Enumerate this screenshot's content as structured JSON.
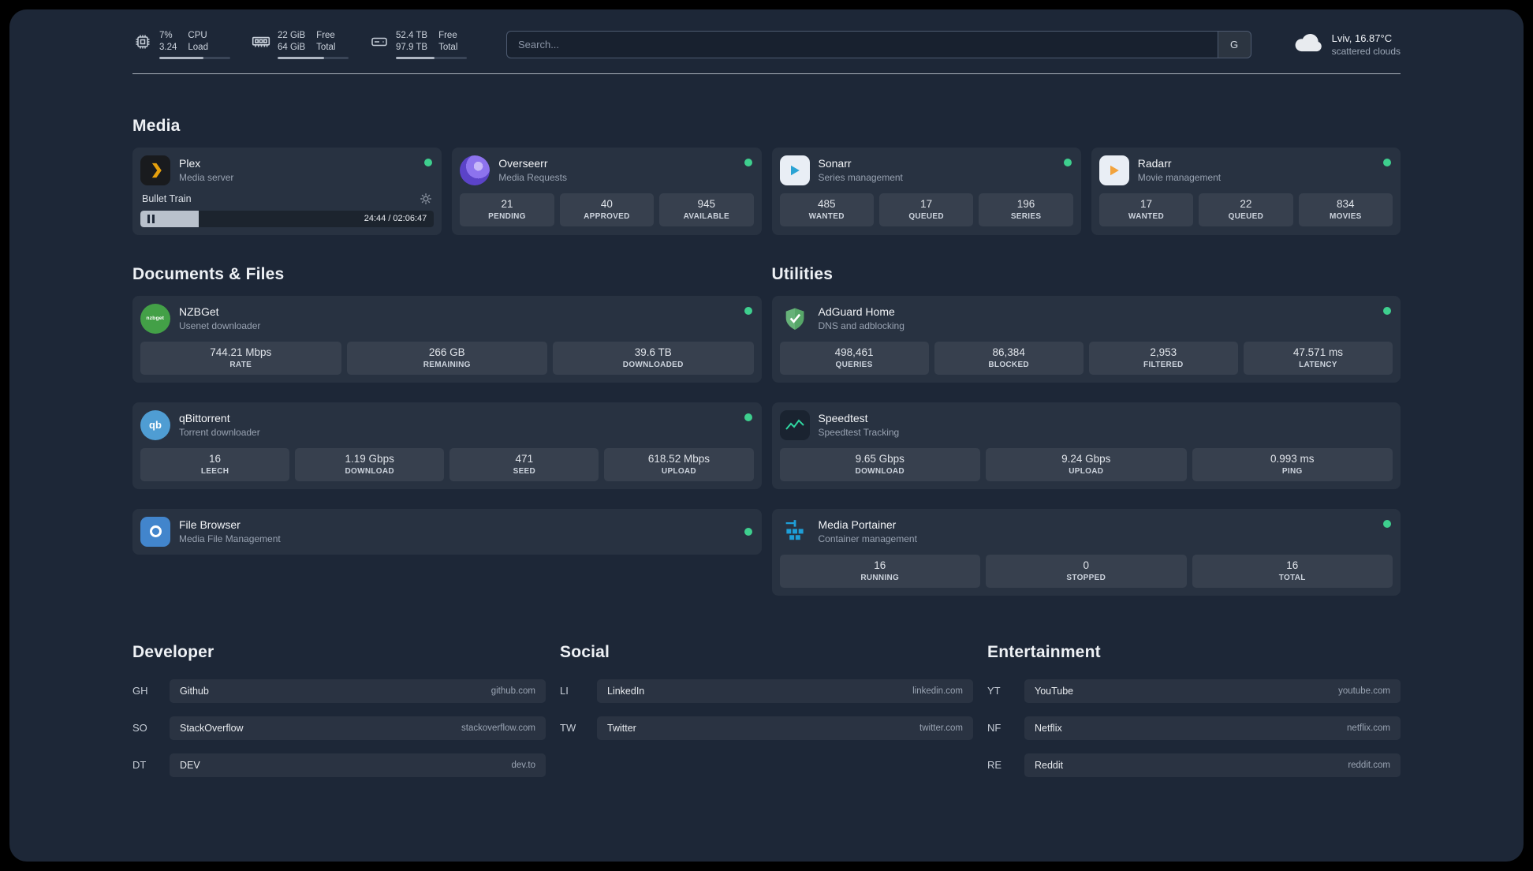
{
  "theme": {
    "background": "#1d2737",
    "accent_green": "#3ecf8e"
  },
  "icons": {
    "cpu": "chip",
    "memory": "ram-stick",
    "disk": "hard-drive",
    "weather": "cloud",
    "settings": "gear",
    "player": "pause",
    "plex": "amber-chevron"
  },
  "header": {
    "cpu": {
      "value_top": "7%",
      "value_bottom": "3.24",
      "label_top": "CPU",
      "label_bottom": "Load",
      "bar_percent": 62
    },
    "memory": {
      "value_top": "22 GiB",
      "value_bottom": "64 GiB",
      "label_top": "Free",
      "label_bottom": "Total",
      "bar_percent": 66
    },
    "disk": {
      "value_top": "52.4 TB",
      "value_bottom": "97.9 TB",
      "label_top": "Free",
      "label_bottom": "Total",
      "bar_percent": 54
    },
    "search": {
      "placeholder": "Search...",
      "provider": "G"
    },
    "weather": {
      "location": "Lviv, 16.87°C",
      "condition": "scattered clouds"
    }
  },
  "media": {
    "title": "Media",
    "cards": {
      "plex": {
        "name": "Plex",
        "subtitle": "Media server",
        "now_playing": "Bullet Train",
        "time": "24:44 / 02:06:47",
        "progress_percent": 20
      },
      "overseerr": {
        "name": "Overseerr",
        "subtitle": "Media Requests",
        "stats": [
          {
            "value": "21",
            "label": "PENDING"
          },
          {
            "value": "40",
            "label": "APPROVED"
          },
          {
            "value": "945",
            "label": "AVAILABLE"
          }
        ]
      },
      "sonarr": {
        "name": "Sonarr",
        "subtitle": "Series management",
        "stats": [
          {
            "value": "485",
            "label": "WANTED"
          },
          {
            "value": "17",
            "label": "QUEUED"
          },
          {
            "value": "196",
            "label": "SERIES"
          }
        ]
      },
      "radarr": {
        "name": "Radarr",
        "subtitle": "Movie management",
        "stats": [
          {
            "value": "17",
            "label": "WANTED"
          },
          {
            "value": "22",
            "label": "QUEUED"
          },
          {
            "value": "834",
            "label": "MOVIES"
          }
        ]
      }
    }
  },
  "documents": {
    "title": "Documents & Files",
    "cards": {
      "nzbget": {
        "name": "NZBGet",
        "subtitle": "Usenet downloader",
        "icon_text": "nzbget",
        "stats": [
          {
            "value": "744.21 Mbps",
            "label": "RATE"
          },
          {
            "value": "266 GB",
            "label": "REMAINING"
          },
          {
            "value": "39.6 TB",
            "label": "DOWNLOADED"
          }
        ]
      },
      "qbittorrent": {
        "name": "qBittorrent",
        "subtitle": "Torrent downloader",
        "icon_text": "qb",
        "stats": [
          {
            "value": "16",
            "label": "LEECH"
          },
          {
            "value": "1.19 Gbps",
            "label": "DOWNLOAD"
          },
          {
            "value": "471",
            "label": "SEED"
          },
          {
            "value": "618.52 Mbps",
            "label": "UPLOAD"
          }
        ]
      },
      "filebrowser": {
        "name": "File Browser",
        "subtitle": "Media File Management"
      }
    }
  },
  "utilities": {
    "title": "Utilities",
    "cards": {
      "adguard": {
        "name": "AdGuard Home",
        "subtitle": "DNS and adblocking",
        "stats": [
          {
            "value": "498,461",
            "label": "QUERIES"
          },
          {
            "value": "86,384",
            "label": "BLOCKED"
          },
          {
            "value": "2,953",
            "label": "FILTERED"
          },
          {
            "value": "47.571 ms",
            "label": "LATENCY"
          }
        ]
      },
      "speedtest": {
        "name": "Speedtest",
        "subtitle": "Speedtest Tracking",
        "stats": [
          {
            "value": "9.65 Gbps",
            "label": "DOWNLOAD"
          },
          {
            "value": "9.24 Gbps",
            "label": "UPLOAD"
          },
          {
            "value": "0.993 ms",
            "label": "PING"
          }
        ]
      },
      "portainer": {
        "name": "Media Portainer",
        "subtitle": "Container management",
        "stats": [
          {
            "value": "16",
            "label": "RUNNING"
          },
          {
            "value": "0",
            "label": "STOPPED"
          },
          {
            "value": "16",
            "label": "TOTAL"
          }
        ]
      }
    }
  },
  "bookmarks": {
    "developer": {
      "title": "Developer",
      "items": [
        {
          "abbr": "GH",
          "name": "Github",
          "url": "github.com"
        },
        {
          "abbr": "SO",
          "name": "StackOverflow",
          "url": "stackoverflow.com"
        },
        {
          "abbr": "DT",
          "name": "DEV",
          "url": "dev.to"
        }
      ]
    },
    "social": {
      "title": "Social",
      "items": [
        {
          "abbr": "LI",
          "name": "LinkedIn",
          "url": "linkedin.com"
        },
        {
          "abbr": "TW",
          "name": "Twitter",
          "url": "twitter.com"
        }
      ]
    },
    "entertainment": {
      "title": "Entertainment",
      "items": [
        {
          "abbr": "YT",
          "name": "YouTube",
          "url": "youtube.com"
        },
        {
          "abbr": "NF",
          "name": "Netflix",
          "url": "netflix.com"
        },
        {
          "abbr": "RE",
          "name": "Reddit",
          "url": "reddit.com"
        }
      ]
    }
  }
}
